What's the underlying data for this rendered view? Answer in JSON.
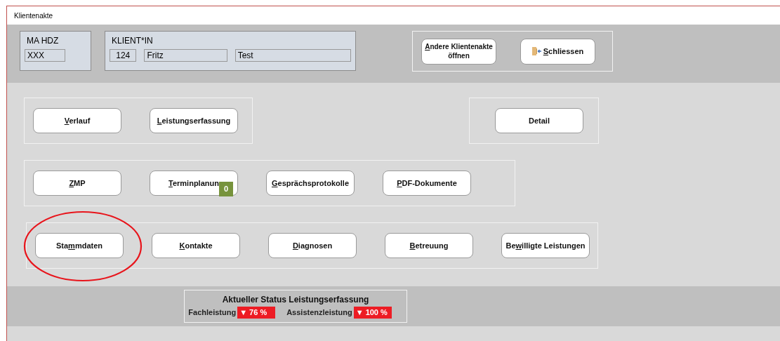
{
  "window": {
    "title": "Klientenakte"
  },
  "header": {
    "staff": {
      "label": "MA HDZ",
      "value": "XXX"
    },
    "client": {
      "label": "KLIENT*IN",
      "fields": [
        "124",
        "Fritz",
        "Test"
      ]
    },
    "actions": [
      {
        "kind": "text",
        "hotkey": "A",
        "after": "ndere Klientenakte öffnen"
      },
      {
        "kind": "exit",
        "hotkey": "S",
        "after": "chliessen"
      }
    ]
  },
  "groups": [
    {
      "buttons": [
        {
          "hotkey": "V",
          "after": "erlauf",
          "circled": false
        },
        {
          "hotkey": "L",
          "after": "eistungserfassung",
          "circled": false
        }
      ]
    },
    {
      "buttons": [
        {
          "after": "Detail",
          "circled": false
        }
      ]
    },
    {
      "buttons": [
        {
          "hotkey": "Z",
          "after": "MP",
          "circled": false
        },
        {
          "hotkey": "T",
          "after": "erminplanun",
          "badge": "0",
          "circled": false
        },
        {
          "hotkey": "G",
          "after": "esprächsprotokolle",
          "circled": false
        },
        {
          "hotkey": "P",
          "after": "DF-Dokumente",
          "circled": false
        }
      ]
    },
    {
      "buttons": [
        {
          "before": "Sta",
          "hotkey": "m",
          "after": "mdaten",
          "circled": true
        },
        {
          "hotkey": "K",
          "after": "ontakte",
          "circled": false
        },
        {
          "hotkey": "D",
          "after": "iagnosen",
          "circled": false
        },
        {
          "hotkey": "B",
          "after": "etreuung",
          "circled": false
        },
        {
          "before": "Be",
          "hotkey": "w",
          "after": "illigte Leistungen",
          "circled": false
        }
      ]
    }
  ],
  "status": {
    "title": "Aktueller Status Leistungserfassung",
    "items": [
      {
        "label": "Fachleistung",
        "value": "▼ 76 %"
      },
      {
        "label": "Assistenzleistung",
        "value": "▼ 100 %"
      }
    ]
  }
}
